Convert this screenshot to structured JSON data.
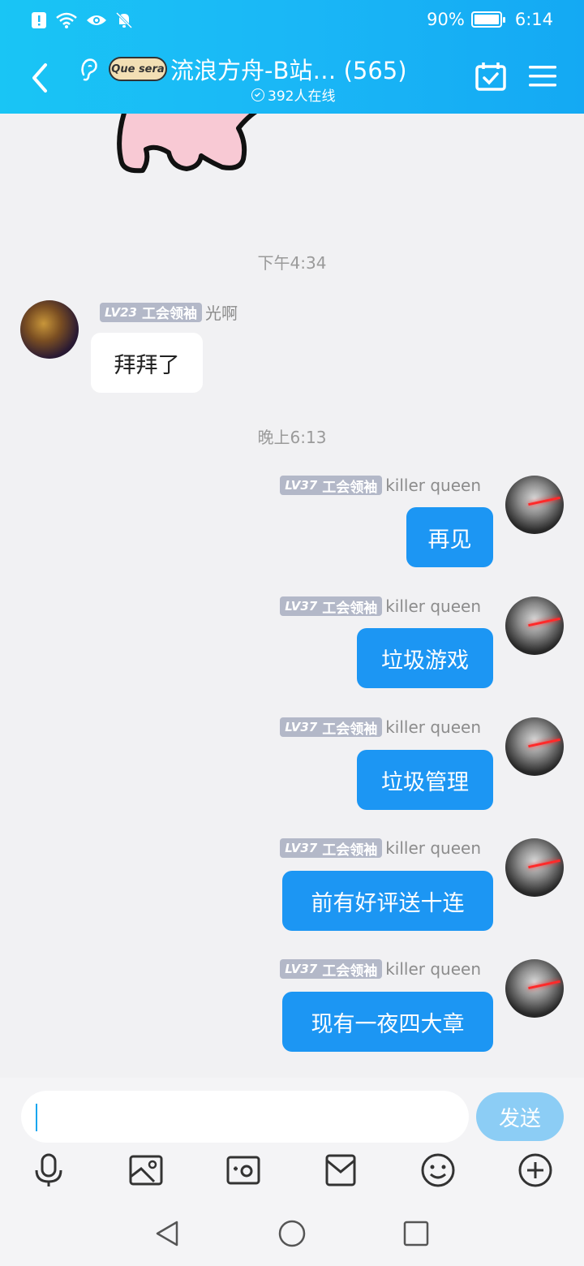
{
  "status_bar": {
    "battery": "90%",
    "battery_level": 0.9,
    "time": "6:14"
  },
  "header": {
    "logo_text": "Que sera",
    "title": "流浪方舟-B站…",
    "member_count": "(565)",
    "online": "392人在线"
  },
  "chat": {
    "messages": [
      {
        "type": "timestamp",
        "text": "下午4:34"
      },
      {
        "type": "incoming",
        "level": "LV23",
        "role": "工会领袖",
        "name": "光啊",
        "text": "拜拜了"
      },
      {
        "type": "timestamp",
        "text": "晚上6:13"
      },
      {
        "type": "outgoing",
        "level": "LV37",
        "role": "工会领袖",
        "name": "killer queen",
        "text": "再见"
      },
      {
        "type": "outgoing",
        "level": "LV37",
        "role": "工会领袖",
        "name": "killer queen",
        "text": "垃圾游戏"
      },
      {
        "type": "outgoing",
        "level": "LV37",
        "role": "工会领袖",
        "name": "killer queen",
        "text": "垃圾管理"
      },
      {
        "type": "outgoing",
        "level": "LV37",
        "role": "工会领袖",
        "name": "killer queen",
        "text": "前有好评送十连"
      },
      {
        "type": "outgoing",
        "level": "LV37",
        "role": "工会领袖",
        "name": "killer queen",
        "text": "现有一夜四大章"
      }
    ]
  },
  "composer": {
    "input_value": "",
    "send_label": "发送"
  },
  "tools": [
    "microphone-icon",
    "image-icon",
    "camera-icon",
    "red-packet-icon",
    "emoji-icon",
    "plus-icon"
  ],
  "colors": {
    "header": "#1ab7f6",
    "outgoing_bubble": "#1c96f3",
    "send_button": "#8ccdf5",
    "badge": "#b3b8c8"
  }
}
